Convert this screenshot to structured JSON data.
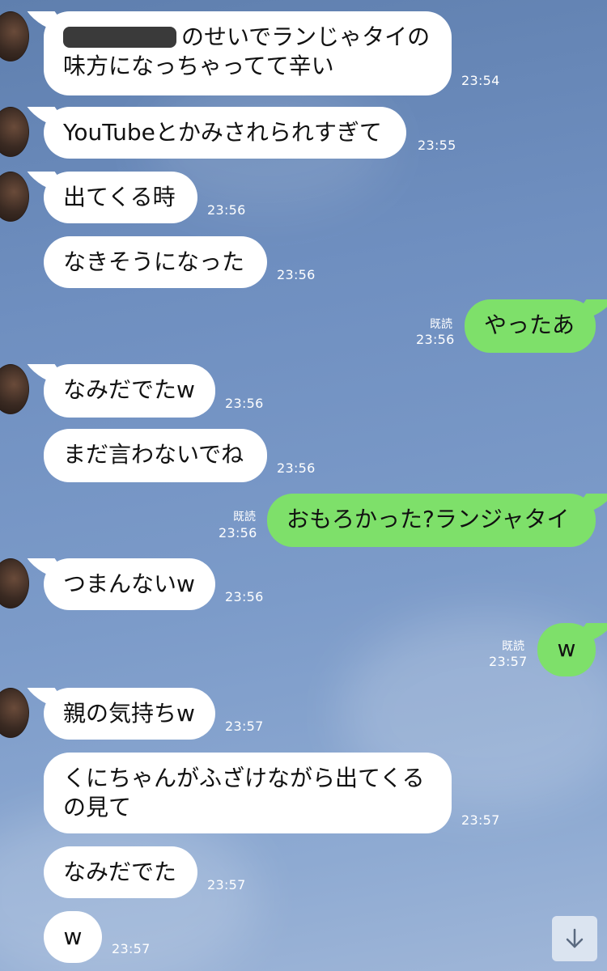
{
  "messages": {
    "m1": {
      "text_after_redaction": "のせいでランじゃタイの",
      "line2": "味方になっちゃってて辛い",
      "time": "23:54"
    },
    "m2": {
      "text": "YouTubeとかみされられすぎて",
      "time": "23:55"
    },
    "m3": {
      "text": "出てくる時",
      "time": "23:56"
    },
    "m4": {
      "text": "なきそうになった",
      "time": "23:56"
    },
    "m5": {
      "text": "やったあ",
      "time": "23:56",
      "read": "既読"
    },
    "m6": {
      "text": "なみだでたw",
      "time": "23:56"
    },
    "m7": {
      "text": "まだ言わないでね",
      "time": "23:56"
    },
    "m8": {
      "text": "おもろかった?ランジャタイ",
      "time": "23:56",
      "read": "既読"
    },
    "m9": {
      "text": "つまんないw",
      "time": "23:56"
    },
    "m10": {
      "text": "w",
      "time": "23:57",
      "read": "既読"
    },
    "m11": {
      "text": "親の気持ちw",
      "time": "23:57"
    },
    "m12": {
      "line1": "くにちゃんがふざけながら出てくる",
      "line2": "の見て",
      "time": "23:57"
    },
    "m13": {
      "text": "なみだでた",
      "time": "23:57"
    },
    "m14": {
      "text": "w",
      "time": "23:57"
    }
  },
  "colors": {
    "incoming": "#ffffff",
    "outgoing": "#7ee06a"
  },
  "icons": {
    "scroll_down": "arrow-down-icon"
  }
}
